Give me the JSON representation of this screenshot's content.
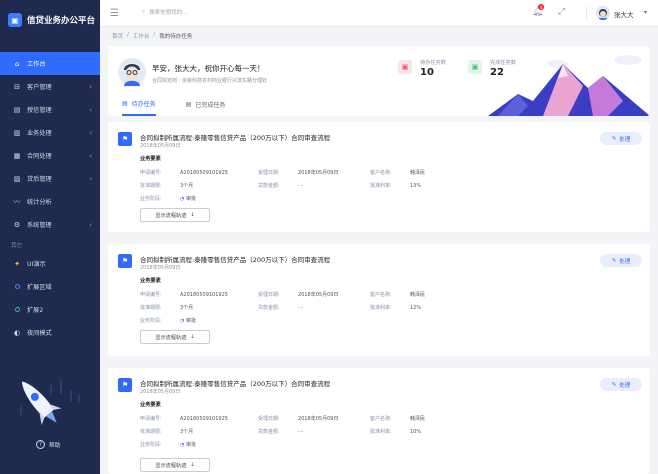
{
  "app": {
    "title": "信贷业务办公平台"
  },
  "sidebar": {
    "items": [
      {
        "label": "工作台",
        "icon": "home-icon",
        "active": true
      },
      {
        "label": "客户管理",
        "icon": "lock-icon",
        "chevron": true
      },
      {
        "label": "授信管理",
        "icon": "briefcase-icon",
        "chevron": true
      },
      {
        "label": "业务处理",
        "icon": "file-icon",
        "chevron": true
      },
      {
        "label": "合同处理",
        "icon": "contract-icon",
        "chevron": true
      },
      {
        "label": "贷后管理",
        "icon": "clipboard-icon",
        "chevron": true
      },
      {
        "label": "统计分析",
        "icon": "analytics-icon",
        "chevron": false
      },
      {
        "label": "系统管理",
        "icon": "gear-icon",
        "chevron": true
      }
    ],
    "group_label": "其它",
    "other_items": [
      {
        "label": "UI演示",
        "icon": "ui-demo-icon",
        "color": "#f5c518"
      },
      {
        "label": "扩展区域",
        "icon": "circle-icon",
        "color": "#4a7dff"
      },
      {
        "label": "扩展2",
        "icon": "circle-icon",
        "color": "#39c07a"
      },
      {
        "label": "夜间模式",
        "icon": "moon-icon",
        "color": "#d4d9e8"
      }
    ],
    "help_label": "帮助"
  },
  "topbar": {
    "search_placeholder": "搜索你想找的...",
    "notification_count": "4",
    "username": "张大大"
  },
  "breadcrumb": [
    "首页",
    "工作台",
    "我的待办任务"
  ],
  "welcome": {
    "greeting": "早安，张大大，祝你开心每一天！",
    "subinfo": "合同拟定岗｜余姚科技农村商业银行兴滨东路分理处",
    "stats": [
      {
        "label": "待办任务数",
        "value": "10",
        "icon": "todo-icon",
        "color": "#f0506e"
      },
      {
        "label": "完成任务数",
        "value": "22",
        "icon": "done-icon",
        "color": "#39c07a"
      }
    ],
    "tabs": [
      {
        "label": "待办任务",
        "icon": "todo-tab-icon",
        "active": true
      },
      {
        "label": "已完成任务",
        "icon": "done-tab-icon",
        "active": false
      }
    ]
  },
  "labels": {
    "section": "业务要素",
    "apply_no": "申请编号:",
    "accept_date": "受理日期:",
    "product_name": "客户名称:",
    "loan_term": "批准期限:",
    "loan_amount": "贷款金额:",
    "rate": "批准利率:",
    "stage": "业务阶段:",
    "trace_button": "显示流程轨迹",
    "handle_button": "处理"
  },
  "tasks": [
    {
      "title": "合同拟制所属流程:泰隆零售信贷产品（200万以下）合同审查流程",
      "date": "2018年05月09日",
      "apply_no": "A201805091019​25",
      "accept_date": "2018年05月09日",
      "product_name": "韩泽民",
      "loan_term": "3个月",
      "loan_amount": "- -",
      "rate": "13%",
      "stage": "审批"
    },
    {
      "title": "合同拟制所属流程:泰隆零售信贷产品（200万以下）合同审查流程",
      "date": "2018年05月09日",
      "apply_no": "A201805091019​25",
      "accept_date": "2018年05月09日",
      "product_name": "韩泽民",
      "loan_term": "3个月",
      "loan_amount": "- -",
      "rate": "12%",
      "stage": "审批"
    },
    {
      "title": "合同拟制所属流程:泰隆零售信贷产品（200万以下）合同审查流程",
      "date": "2018年05月09日",
      "apply_no": "A201805091019​25",
      "accept_date": "2018年05月09日",
      "product_name": "韩泽民",
      "loan_term": "3个月",
      "loan_amount": "- -",
      "rate": "10%",
      "stage": "审批"
    }
  ],
  "colors": {
    "sidebar_bg": "#1f2a4e",
    "accent": "#2f6bff"
  }
}
